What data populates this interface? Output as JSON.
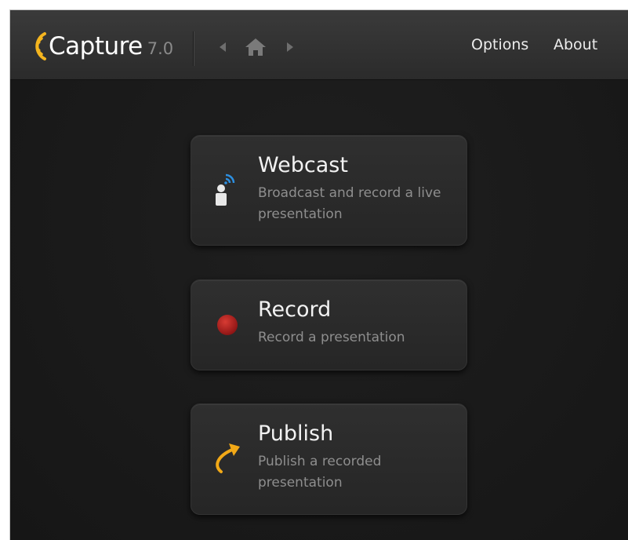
{
  "app": {
    "name": "Capture",
    "version": "7.0"
  },
  "menu": {
    "options_label": "Options",
    "about_label": "About"
  },
  "nav": {
    "back_icon": "chevron-left-icon",
    "home_icon": "home-icon",
    "forward_icon": "chevron-right-icon"
  },
  "colors": {
    "brand_yellow": "#f4b51f",
    "wave_blue": "#2d8fe0",
    "record_red": "#b21f1f"
  },
  "cards": [
    {
      "title": "Webcast",
      "description": "Broadcast and record a live presentation",
      "icon": "webcast-presenter-icon"
    },
    {
      "title": "Record",
      "description": "Record a presentation",
      "icon": "record-dot-icon"
    },
    {
      "title": "Publish",
      "description": "Publish a recorded presentation",
      "icon": "publish-arrow-icon"
    }
  ]
}
